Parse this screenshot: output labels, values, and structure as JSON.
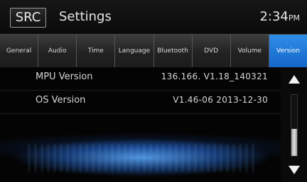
{
  "header": {
    "src_label": "SRC",
    "title": "Settings",
    "time": "2:34",
    "ampm": "PM"
  },
  "tabs": [
    {
      "label": "General",
      "active": false
    },
    {
      "label": "Audio",
      "active": false
    },
    {
      "label": "Time",
      "active": false
    },
    {
      "label": "Language",
      "active": false
    },
    {
      "label": "Bluetooth",
      "active": false
    },
    {
      "label": "DVD",
      "active": false
    },
    {
      "label": "Volume",
      "active": false
    },
    {
      "label": "Version",
      "active": true
    }
  ],
  "rows": [
    {
      "label": "MPU Version",
      "value": "136.166. V1.18_140321"
    },
    {
      "label": "OS Version",
      "value": "V1.46-06 2013-12-30"
    }
  ],
  "colors": {
    "accent": "#1e78d8",
    "background": "#050505",
    "text": "#d6d6d6"
  },
  "scroll": {
    "up_icon": "arrow-up-icon",
    "down_icon": "arrow-down-icon"
  }
}
